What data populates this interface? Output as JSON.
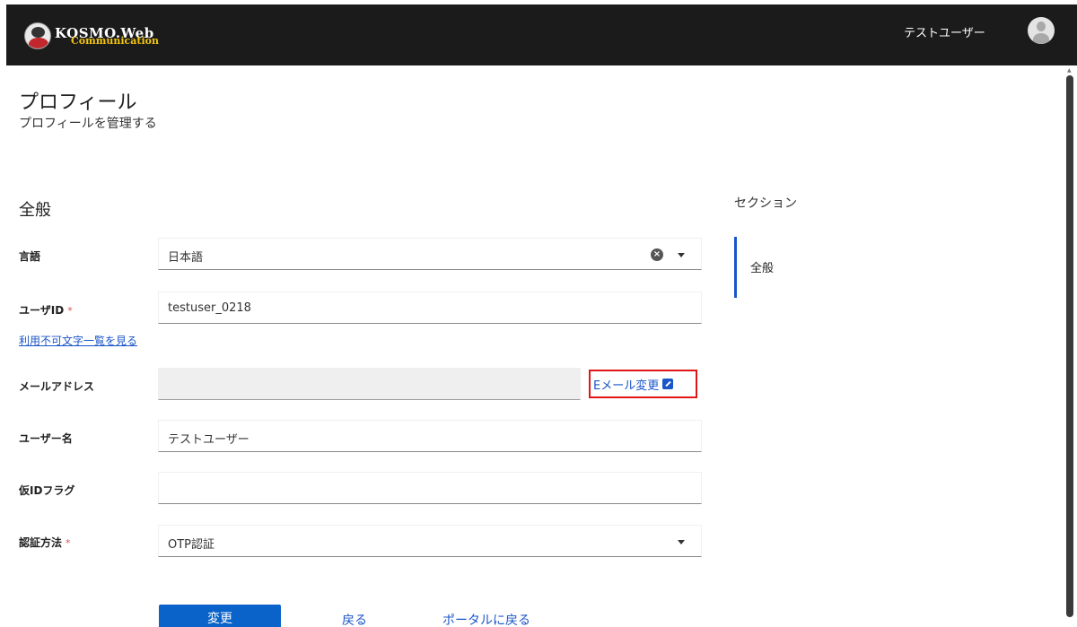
{
  "header": {
    "logo_main": "KOSMO.Web",
    "logo_sub": "Communication",
    "user_name": "テストユーザー"
  },
  "page": {
    "title": "プロフィール",
    "subtitle": "プロフィールを管理する"
  },
  "section": {
    "title": "全般"
  },
  "form": {
    "language": {
      "label": "言語",
      "value": "日本語"
    },
    "user_id": {
      "label": "ユーザID",
      "required_mark": "*",
      "value": "testuser_0218"
    },
    "invalid_chars_link": "利用不可文字一覧を見る",
    "email": {
      "label": "メールアドレス",
      "value": "",
      "change_label": "Eメール変更"
    },
    "user_name": {
      "label": "ユーザー名",
      "value": "テストユーザー"
    },
    "temp_id_flag": {
      "label": "仮IDフラグ",
      "value": ""
    },
    "auth_method": {
      "label": "認証方法",
      "required_mark": "*",
      "value": "OTP認証"
    }
  },
  "side_nav": {
    "heading": "セクション",
    "items": [
      {
        "label": "全般"
      }
    ]
  },
  "actions": {
    "submit": "変更",
    "back": "戻る",
    "back_to_portal": "ポータルに戻る"
  },
  "icons": {
    "clear": "clear-icon",
    "dropdown": "caret-down-icon",
    "external_link": "external-link-icon",
    "avatar": "user-avatar-icon"
  },
  "colors": {
    "header_bg": "#1b1b1b",
    "link": "#1a55c9",
    "primary_button": "#0a63c9",
    "highlight_border": "#e01616",
    "required": "#d9534f"
  }
}
